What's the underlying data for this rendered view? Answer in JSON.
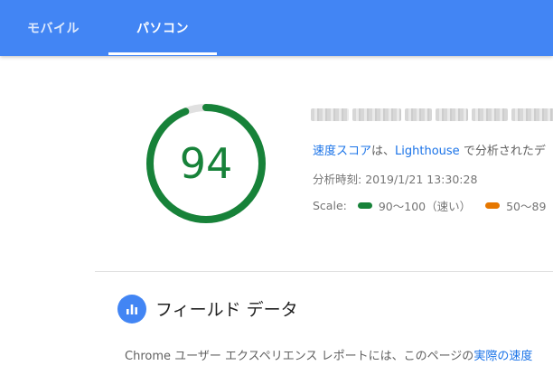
{
  "tabs": [
    {
      "label": "モバイル",
      "active": false
    },
    {
      "label": "パソコン",
      "active": true
    }
  ],
  "score": {
    "value": "94",
    "fraction": 0.94,
    "color": "#178239",
    "track_color": "#e0e0e0"
  },
  "summary": {
    "speed_score_link": "速度スコア",
    "text_1": "は、",
    "lighthouse_link": "Lighthouse",
    "text_2": " で分析されたデ",
    "date_label": "分析時刻: ",
    "date_value": "2019/1/21 13:30:28"
  },
  "scale": {
    "label": "Scale:",
    "items": [
      {
        "label": "90〜100（速い）",
        "color": "#178239"
      },
      {
        "label": "50〜89",
        "color": "#e67700"
      }
    ]
  },
  "field_data": {
    "title": "フィールド データ",
    "description_prefix": "Chrome ユーザー エクスペリエンス レポートには、このページの",
    "description_link": "実際の速度"
  },
  "colors": {
    "tabbar": "#4285f4",
    "accent": "#1a73e8"
  },
  "icons": {
    "field_data": "bar-chart-icon"
  }
}
